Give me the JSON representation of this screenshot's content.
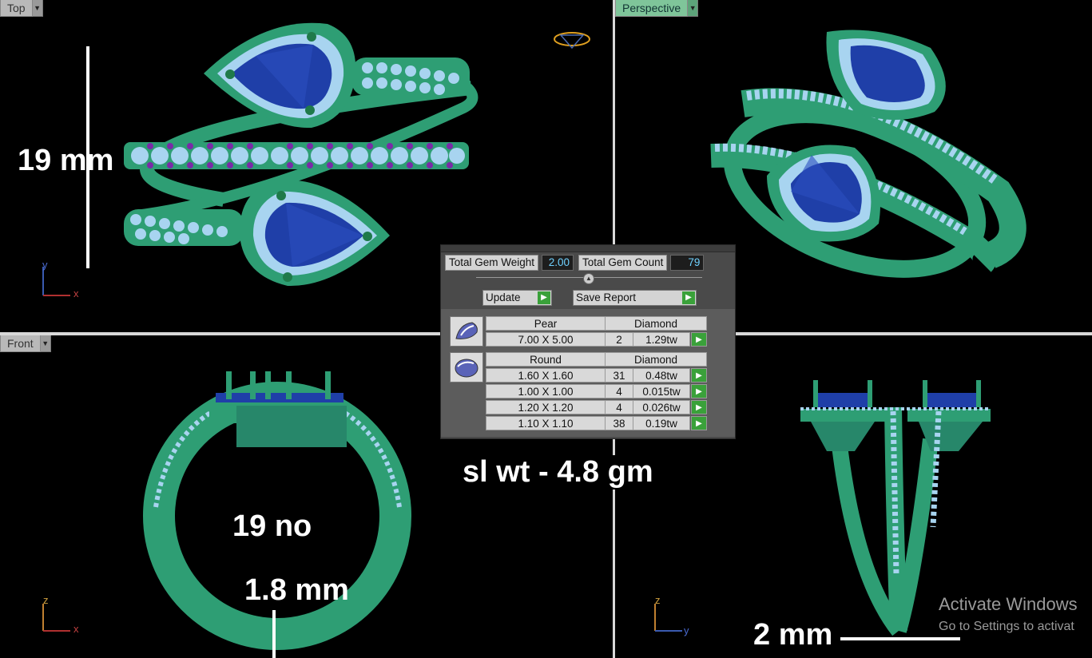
{
  "viewports": {
    "top": {
      "label": "Top"
    },
    "perspective": {
      "label": "Perspective"
    },
    "front": {
      "label": "Front"
    },
    "side": {
      "label": ""
    }
  },
  "axes": {
    "top": {
      "vertical": "y",
      "horizontal": "x"
    },
    "front": {
      "vertical": "z",
      "horizontal": "x"
    },
    "side": {
      "vertical": "z",
      "horizontal": "y"
    }
  },
  "annotations": {
    "height": "19 mm",
    "size": "19 no",
    "shank_width": "1.8 mm",
    "side_width": "2 mm",
    "silver_weight": "sl wt - 4.8 gm"
  },
  "gem_report": {
    "total_weight_label": "Total Gem Weight",
    "total_weight_value": "2.00",
    "total_count_label": "Total Gem Count",
    "total_count_value": "79",
    "update_label": "Update",
    "save_label": "Save Report",
    "groups": [
      {
        "shape": "Pear",
        "material": "Diamond",
        "rows": [
          {
            "size": "7.00 X 5.00",
            "count": "2",
            "weight": "1.29tw"
          }
        ]
      },
      {
        "shape": "Round",
        "material": "Diamond",
        "rows": [
          {
            "size": "1.60 X 1.60",
            "count": "31",
            "weight": "0.48tw"
          },
          {
            "size": "1.00 X 1.00",
            "count": "4",
            "weight": "0.015tw"
          },
          {
            "size": "1.20 X 1.20",
            "count": "4",
            "weight": "0.026tw"
          },
          {
            "size": "1.10 X 1.10",
            "count": "38",
            "weight": "0.19tw"
          }
        ]
      }
    ]
  },
  "watermark": {
    "title": "Activate Windows",
    "subtitle": "Go to Settings to activat"
  },
  "colors": {
    "metal": "#2e9e74",
    "stone": "#1f3fa8",
    "prong": "#7a2aa8",
    "pave": "#a8d4f0",
    "gizmo": "#e0a020"
  }
}
